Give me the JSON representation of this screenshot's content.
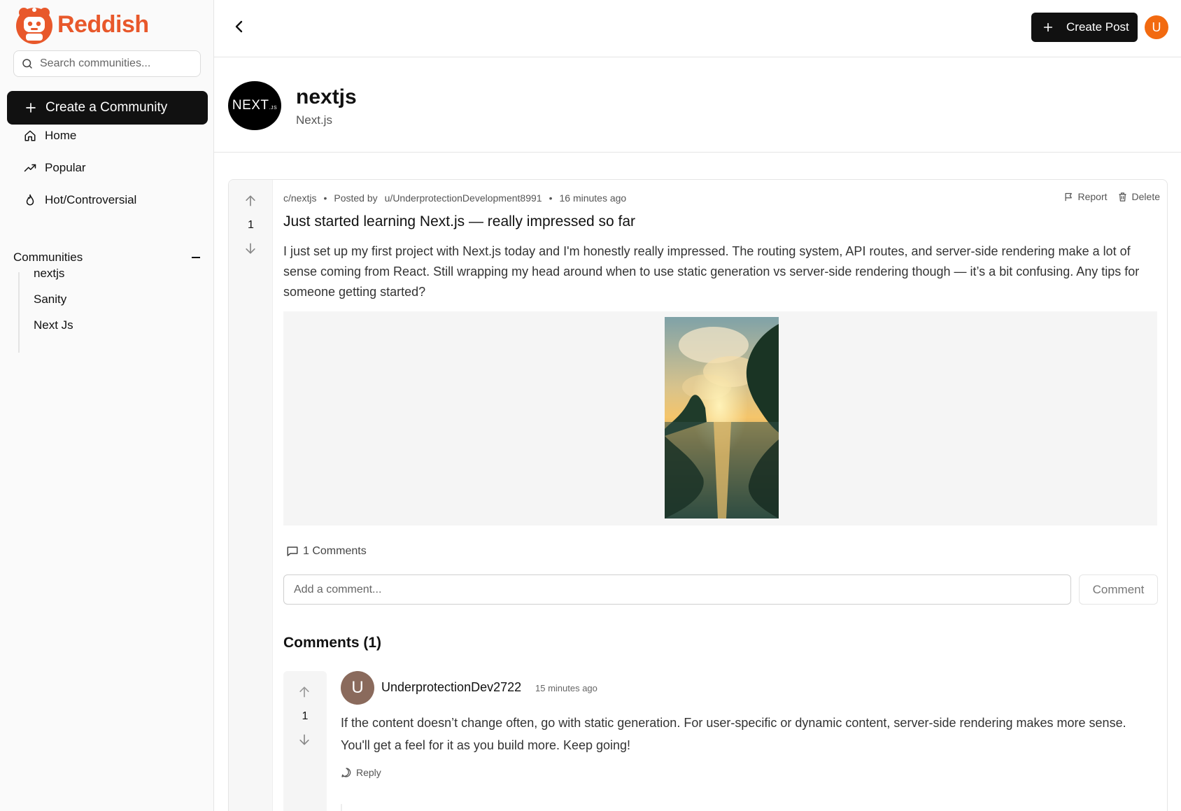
{
  "app": {
    "brand": "Reddish",
    "accent_color": "#e8582b"
  },
  "sidebar": {
    "search_placeholder": "Search communities...",
    "create_community_label": "Create a Community",
    "nav": [
      {
        "label": "Home",
        "icon": "home-icon"
      },
      {
        "label": "Popular",
        "icon": "trending-icon"
      },
      {
        "label": "Hot/Controversial",
        "icon": "flame-icon"
      }
    ],
    "communities_header": "Communities",
    "communities": [
      "nextjs",
      "Sanity",
      "Next Js"
    ]
  },
  "topbar": {
    "create_post_label": "Create Post",
    "user_initial": "U"
  },
  "community": {
    "logo_text": "NEXT",
    "logo_suffix": ".JS",
    "name": "nextjs",
    "title": "Next.js"
  },
  "post": {
    "community": "c/nextjs",
    "posted_by_label": "Posted by",
    "author": "u/UnderprotectionDevelopment8991",
    "time": "16 minutes ago",
    "report_label": "Report",
    "delete_label": "Delete",
    "votes": "1",
    "title": "Just started learning Next.js — really impressed so far",
    "body": "I just set up my first project with Next.js today and I'm honestly really impressed. The routing system, API routes, and server-side rendering make a lot of sense coming from React. Still wrapping my head around when to use static generation vs server-side rendering though — it’s a bit confusing. Any tips for someone getting started?",
    "comments_count_label": "1 Comments",
    "comment_placeholder": "Add a comment...",
    "comment_button_label": "Comment"
  },
  "comments": {
    "heading": "Comments (1)",
    "items": [
      {
        "initial": "U",
        "author": "UnderprotectionDev2722",
        "time": "15 minutes ago",
        "votes": "1",
        "text": "If the content doesn’t change often, go with static generation. For user-specific or dynamic content, server-side rendering makes more sense. You'll get a feel for it as you build more. Keep going!",
        "reply_label": "Reply"
      }
    ]
  }
}
